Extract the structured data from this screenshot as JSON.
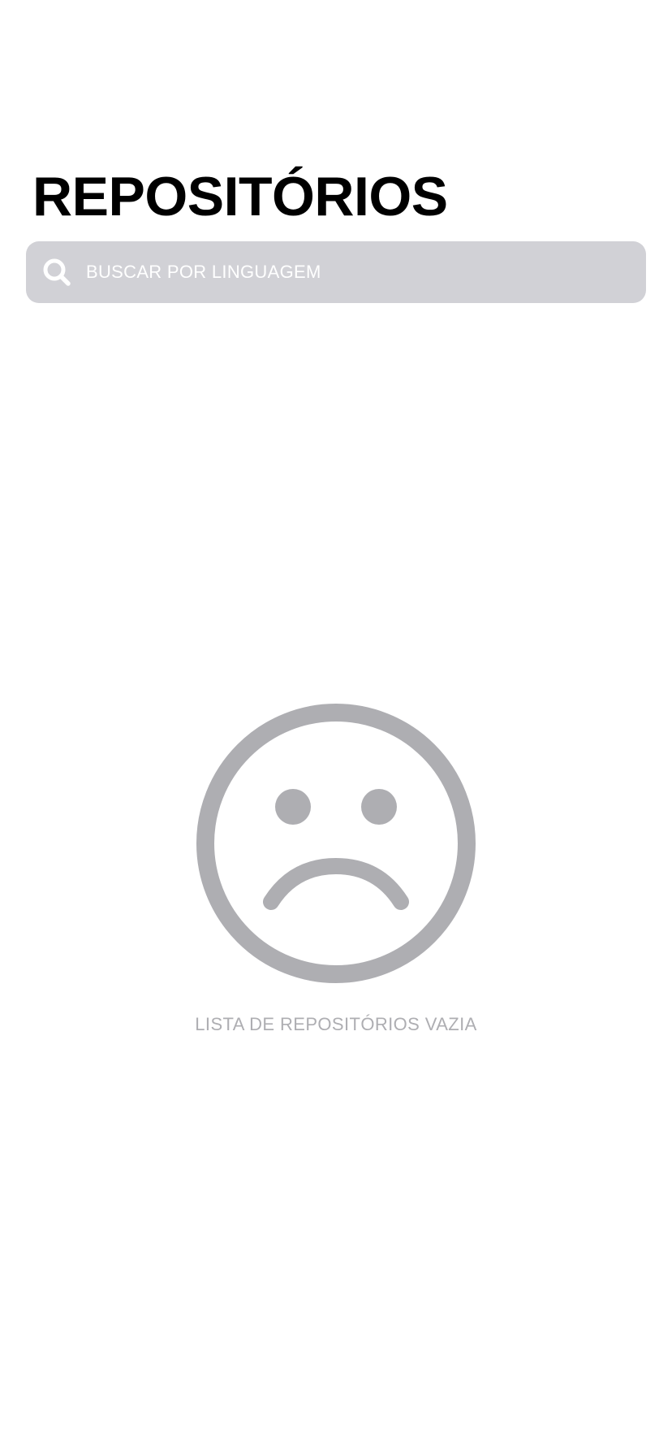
{
  "header": {
    "title": "REPOSITÓRIOS"
  },
  "search": {
    "icon": "search-icon",
    "placeholder": "BUSCAR POR LINGUAGEM",
    "value": ""
  },
  "empty_state": {
    "icon": "sad-face-icon",
    "message": "LISTA DE REPOSITÓRIOS VAZIA"
  },
  "colors": {
    "search_background": "#d1d1d6",
    "muted_gray": "#aeaeb2",
    "title": "#000000",
    "background": "#ffffff"
  }
}
